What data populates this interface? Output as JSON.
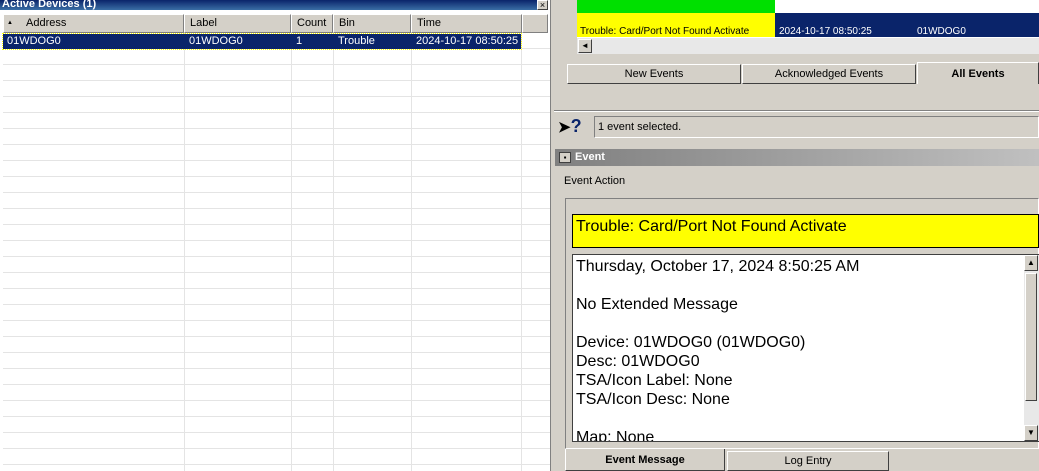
{
  "left_panel": {
    "title": "Active Devices (1)",
    "close_glyph": "×",
    "columns": [
      "Address",
      "Label",
      "Count",
      "Bin",
      "Time"
    ],
    "sort_glyph": "▲",
    "rows": [
      {
        "address": "01WDOG0",
        "label": "01WDOG0",
        "count": "1",
        "bin": "Trouble",
        "time": "2024-10-17 08:50:25"
      }
    ]
  },
  "event_list": {
    "row": {
      "text": "Trouble: Card/Port Not Found Activate",
      "time": "2024-10-17 08:50:25",
      "device": "01WDOG0"
    },
    "scroll_left_glyph": "◄",
    "tabs": [
      "New Events",
      "Acknowledged Events",
      "All Events"
    ]
  },
  "status": {
    "text": "1 event selected.",
    "help_glyph": "?"
  },
  "event_panel": {
    "title": "Event",
    "action_label": "Event Action",
    "banner": "Trouble: Card/Port Not Found Activate",
    "message": "Thursday, October 17, 2024 8:50:25 AM\n\nNo Extended Message\n\nDevice: 01WDOG0 (01WDOG0)\nDesc: 01WDOG0\nTSA/Icon Label: None\nTSA/Icon Desc: None\n\nMap: None",
    "scroll_up_glyph": "▲",
    "scroll_down_glyph": "▼",
    "tabs": [
      "Event Message",
      "Log Entry"
    ]
  },
  "colors": {
    "selection": "#0a246a",
    "banner": "#ffff00",
    "green_strip": "#00e000"
  }
}
